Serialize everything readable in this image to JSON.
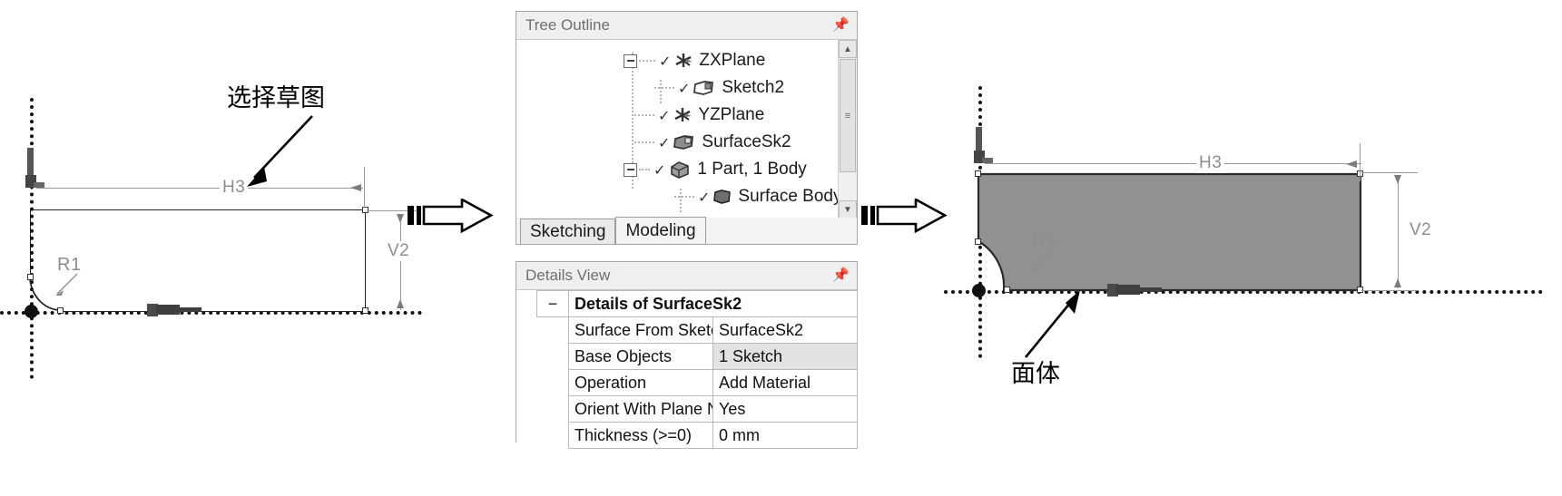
{
  "left_sketch": {
    "annotation": "选择草图",
    "dimensions": {
      "h3": "H3",
      "v2": "V2",
      "r1": "R1"
    }
  },
  "right_sketch": {
    "annotation": "面体",
    "dimensions": {
      "h3": "H3",
      "v2": "V2",
      "r1": "R1"
    },
    "fill_color": "#919191"
  },
  "tree_panel": {
    "title": "Tree Outline",
    "pin_icon": "pin-icon",
    "scroll": {
      "up": "▲",
      "down": "▼",
      "thumb": "≡"
    },
    "items": [
      {
        "label": "ZXPlane",
        "icon": "plane-icon",
        "indent": 0,
        "expander": true,
        "check": true
      },
      {
        "label": "Sketch2",
        "icon": "sketch-icon",
        "indent": 1,
        "expander": false,
        "check": true
      },
      {
        "label": "YZPlane",
        "icon": "plane-icon",
        "indent": 0,
        "expander": false,
        "check": true
      },
      {
        "label": "SurfaceSk2",
        "icon": "surface-icon",
        "indent": 0,
        "expander": false,
        "check": true
      },
      {
        "label": "1 Part, 1 Body",
        "icon": "part-body-icon",
        "indent": 0,
        "expander": true,
        "check": true
      },
      {
        "label": "Surface Body",
        "icon": "surface-body-icon",
        "indent": 1,
        "expander": false,
        "check": true
      }
    ],
    "tabs": [
      {
        "label": "Sketching",
        "active": false
      },
      {
        "label": "Modeling",
        "active": true
      }
    ]
  },
  "details_panel": {
    "title": "Details View",
    "pin_icon": "pin-icon",
    "group_header": "Details of SurfaceSk2",
    "group_expander": "−",
    "rows": [
      {
        "name": "Surface From Sketches",
        "value": "SurfaceSk2",
        "value_gray": false
      },
      {
        "name": "Base Objects",
        "value": "1 Sketch",
        "value_gray": true
      },
      {
        "name": "Operation",
        "value": "Add Material",
        "value_gray": false
      },
      {
        "name": "Orient With Plane Normal?",
        "value": "Yes",
        "value_gray": false
      },
      {
        "name": "Thickness (>=0)",
        "value": "0 mm",
        "value_gray": false
      }
    ]
  },
  "flow": {
    "arrow1": "block-arrow-right-icon",
    "arrow2": "block-arrow-right-icon"
  }
}
